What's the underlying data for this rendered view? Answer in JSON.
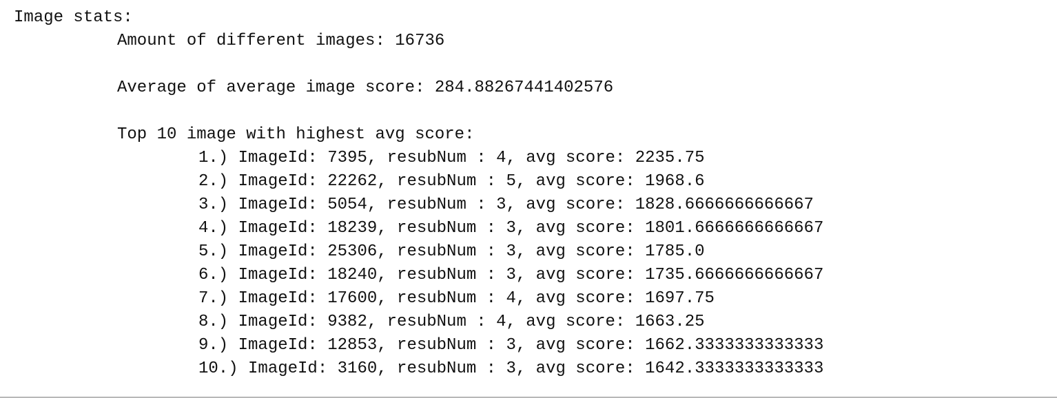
{
  "output": {
    "header": "Image stats:",
    "amount_line": "Amount of different images: 16736",
    "average_line": "Average of average image score: 284.88267441402576",
    "top_header": "Top 10 image with highest avg score:",
    "top_items": [
      "1.) ImageId: 7395, resubNum : 4, avg score: 2235.75",
      "2.) ImageId: 22262, resubNum : 5, avg score: 1968.6",
      "3.) ImageId: 5054, resubNum : 3, avg score: 1828.6666666666667",
      "4.) ImageId: 18239, resubNum : 3, avg score: 1801.6666666666667",
      "5.) ImageId: 25306, resubNum : 3, avg score: 1785.0",
      "6.) ImageId: 18240, resubNum : 3, avg score: 1735.6666666666667",
      "7.) ImageId: 17600, resubNum : 4, avg score: 1697.75",
      "8.) ImageId: 9382, resubNum : 4, avg score: 1663.25",
      "9.) ImageId: 12853, resubNum : 3, avg score: 1662.3333333333333",
      "10.) ImageId: 3160, resubNum : 3, avg score: 1642.3333333333333"
    ]
  }
}
